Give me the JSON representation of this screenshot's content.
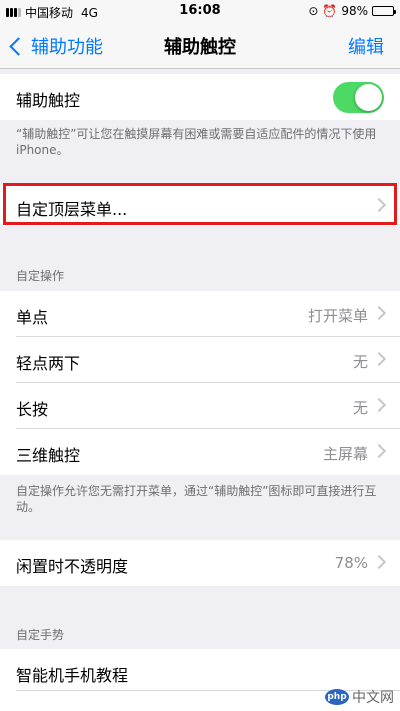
{
  "status_bar": {
    "carrier": "中国移动",
    "network": "4G",
    "time": "16:08",
    "battery_percent": "98%",
    "battery_level": 0.98
  },
  "nav": {
    "back_label": "辅助功能",
    "title": "辅助触控",
    "edit_label": "编辑"
  },
  "assistive_touch": {
    "label": "辅助触控",
    "enabled": true,
    "description": "“辅助触控”可让您在触摸屏幕有困难或需要自适应配件的情况下使用 iPhone。"
  },
  "customize_menu": {
    "label": "自定顶层菜单..."
  },
  "custom_actions": {
    "header": "自定操作",
    "rows": [
      {
        "label": "单点",
        "value": "打开菜单"
      },
      {
        "label": "轻点两下",
        "value": "无"
      },
      {
        "label": "长按",
        "value": "无"
      },
      {
        "label": "三维触控",
        "value": "主屏幕"
      }
    ],
    "footnote": "自定操作允许您无需打开菜单，通过“辅助触控”图标即可直接进行互动。"
  },
  "idle_opacity": {
    "label": "闲置时不透明度",
    "value": "78%"
  },
  "custom_gestures": {
    "header": "自定手势",
    "first_item": "智能机手机教程"
  },
  "watermark": {
    "logo_text": "php",
    "text": "中文网"
  },
  "colors": {
    "accent": "#007aff",
    "toggle_on": "#4cd964",
    "highlight": "#e31b1b"
  }
}
